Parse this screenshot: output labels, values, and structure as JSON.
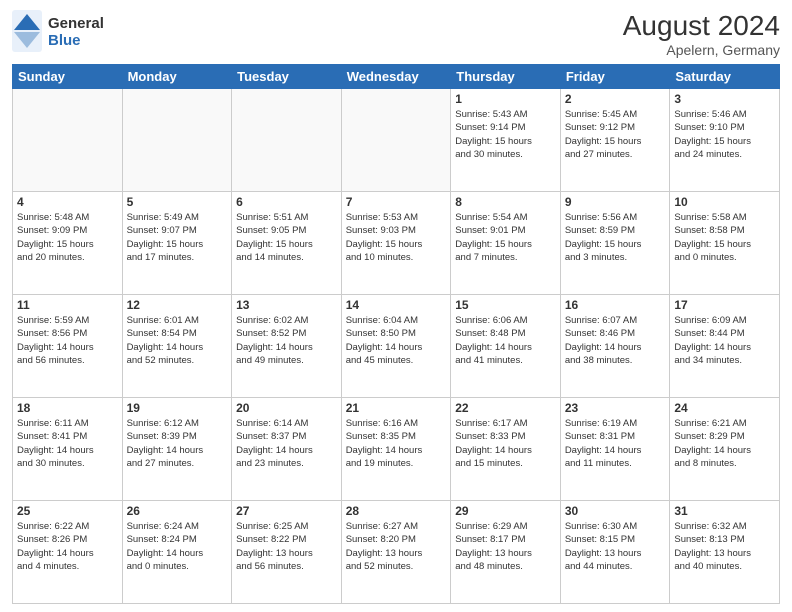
{
  "header": {
    "logo_general": "General",
    "logo_blue": "Blue",
    "month_year": "August 2024",
    "location": "Apelern, Germany"
  },
  "days_of_week": [
    "Sunday",
    "Monday",
    "Tuesday",
    "Wednesday",
    "Thursday",
    "Friday",
    "Saturday"
  ],
  "weeks": [
    [
      {
        "day": "",
        "info": []
      },
      {
        "day": "",
        "info": []
      },
      {
        "day": "",
        "info": []
      },
      {
        "day": "",
        "info": []
      },
      {
        "day": "1",
        "info": [
          "Sunrise: 5:43 AM",
          "Sunset: 9:14 PM",
          "Daylight: 15 hours",
          "and 30 minutes."
        ]
      },
      {
        "day": "2",
        "info": [
          "Sunrise: 5:45 AM",
          "Sunset: 9:12 PM",
          "Daylight: 15 hours",
          "and 27 minutes."
        ]
      },
      {
        "day": "3",
        "info": [
          "Sunrise: 5:46 AM",
          "Sunset: 9:10 PM",
          "Daylight: 15 hours",
          "and 24 minutes."
        ]
      }
    ],
    [
      {
        "day": "4",
        "info": [
          "Sunrise: 5:48 AM",
          "Sunset: 9:09 PM",
          "Daylight: 15 hours",
          "and 20 minutes."
        ]
      },
      {
        "day": "5",
        "info": [
          "Sunrise: 5:49 AM",
          "Sunset: 9:07 PM",
          "Daylight: 15 hours",
          "and 17 minutes."
        ]
      },
      {
        "day": "6",
        "info": [
          "Sunrise: 5:51 AM",
          "Sunset: 9:05 PM",
          "Daylight: 15 hours",
          "and 14 minutes."
        ]
      },
      {
        "day": "7",
        "info": [
          "Sunrise: 5:53 AM",
          "Sunset: 9:03 PM",
          "Daylight: 15 hours",
          "and 10 minutes."
        ]
      },
      {
        "day": "8",
        "info": [
          "Sunrise: 5:54 AM",
          "Sunset: 9:01 PM",
          "Daylight: 15 hours",
          "and 7 minutes."
        ]
      },
      {
        "day": "9",
        "info": [
          "Sunrise: 5:56 AM",
          "Sunset: 8:59 PM",
          "Daylight: 15 hours",
          "and 3 minutes."
        ]
      },
      {
        "day": "10",
        "info": [
          "Sunrise: 5:58 AM",
          "Sunset: 8:58 PM",
          "Daylight: 15 hours",
          "and 0 minutes."
        ]
      }
    ],
    [
      {
        "day": "11",
        "info": [
          "Sunrise: 5:59 AM",
          "Sunset: 8:56 PM",
          "Daylight: 14 hours",
          "and 56 minutes."
        ]
      },
      {
        "day": "12",
        "info": [
          "Sunrise: 6:01 AM",
          "Sunset: 8:54 PM",
          "Daylight: 14 hours",
          "and 52 minutes."
        ]
      },
      {
        "day": "13",
        "info": [
          "Sunrise: 6:02 AM",
          "Sunset: 8:52 PM",
          "Daylight: 14 hours",
          "and 49 minutes."
        ]
      },
      {
        "day": "14",
        "info": [
          "Sunrise: 6:04 AM",
          "Sunset: 8:50 PM",
          "Daylight: 14 hours",
          "and 45 minutes."
        ]
      },
      {
        "day": "15",
        "info": [
          "Sunrise: 6:06 AM",
          "Sunset: 8:48 PM",
          "Daylight: 14 hours",
          "and 41 minutes."
        ]
      },
      {
        "day": "16",
        "info": [
          "Sunrise: 6:07 AM",
          "Sunset: 8:46 PM",
          "Daylight: 14 hours",
          "and 38 minutes."
        ]
      },
      {
        "day": "17",
        "info": [
          "Sunrise: 6:09 AM",
          "Sunset: 8:44 PM",
          "Daylight: 14 hours",
          "and 34 minutes."
        ]
      }
    ],
    [
      {
        "day": "18",
        "info": [
          "Sunrise: 6:11 AM",
          "Sunset: 8:41 PM",
          "Daylight: 14 hours",
          "and 30 minutes."
        ]
      },
      {
        "day": "19",
        "info": [
          "Sunrise: 6:12 AM",
          "Sunset: 8:39 PM",
          "Daylight: 14 hours",
          "and 27 minutes."
        ]
      },
      {
        "day": "20",
        "info": [
          "Sunrise: 6:14 AM",
          "Sunset: 8:37 PM",
          "Daylight: 14 hours",
          "and 23 minutes."
        ]
      },
      {
        "day": "21",
        "info": [
          "Sunrise: 6:16 AM",
          "Sunset: 8:35 PM",
          "Daylight: 14 hours",
          "and 19 minutes."
        ]
      },
      {
        "day": "22",
        "info": [
          "Sunrise: 6:17 AM",
          "Sunset: 8:33 PM",
          "Daylight: 14 hours",
          "and 15 minutes."
        ]
      },
      {
        "day": "23",
        "info": [
          "Sunrise: 6:19 AM",
          "Sunset: 8:31 PM",
          "Daylight: 14 hours",
          "and 11 minutes."
        ]
      },
      {
        "day": "24",
        "info": [
          "Sunrise: 6:21 AM",
          "Sunset: 8:29 PM",
          "Daylight: 14 hours",
          "and 8 minutes."
        ]
      }
    ],
    [
      {
        "day": "25",
        "info": [
          "Sunrise: 6:22 AM",
          "Sunset: 8:26 PM",
          "Daylight: 14 hours",
          "and 4 minutes."
        ]
      },
      {
        "day": "26",
        "info": [
          "Sunrise: 6:24 AM",
          "Sunset: 8:24 PM",
          "Daylight: 14 hours",
          "and 0 minutes."
        ]
      },
      {
        "day": "27",
        "info": [
          "Sunrise: 6:25 AM",
          "Sunset: 8:22 PM",
          "Daylight: 13 hours",
          "and 56 minutes."
        ]
      },
      {
        "day": "28",
        "info": [
          "Sunrise: 6:27 AM",
          "Sunset: 8:20 PM",
          "Daylight: 13 hours",
          "and 52 minutes."
        ]
      },
      {
        "day": "29",
        "info": [
          "Sunrise: 6:29 AM",
          "Sunset: 8:17 PM",
          "Daylight: 13 hours",
          "and 48 minutes."
        ]
      },
      {
        "day": "30",
        "info": [
          "Sunrise: 6:30 AM",
          "Sunset: 8:15 PM",
          "Daylight: 13 hours",
          "and 44 minutes."
        ]
      },
      {
        "day": "31",
        "info": [
          "Sunrise: 6:32 AM",
          "Sunset: 8:13 PM",
          "Daylight: 13 hours",
          "and 40 minutes."
        ]
      }
    ]
  ]
}
